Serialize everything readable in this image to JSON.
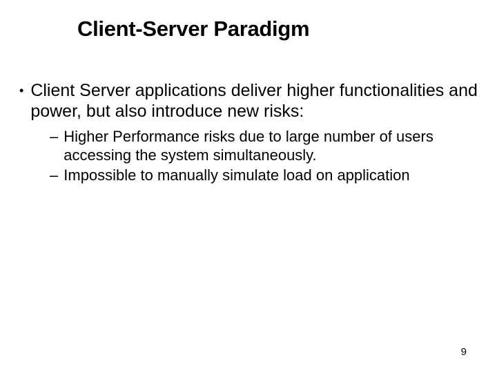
{
  "slide": {
    "title": "Client-Server Paradigm",
    "bullets": [
      {
        "text": "Client Server applications deliver higher functionalities and power, but also introduce new risks:",
        "sub": [
          "Higher Performance risks due to large number of users accessing the system simultaneously.",
          "Impossible to manually simulate load on application"
        ]
      }
    ],
    "page_number": "9"
  }
}
